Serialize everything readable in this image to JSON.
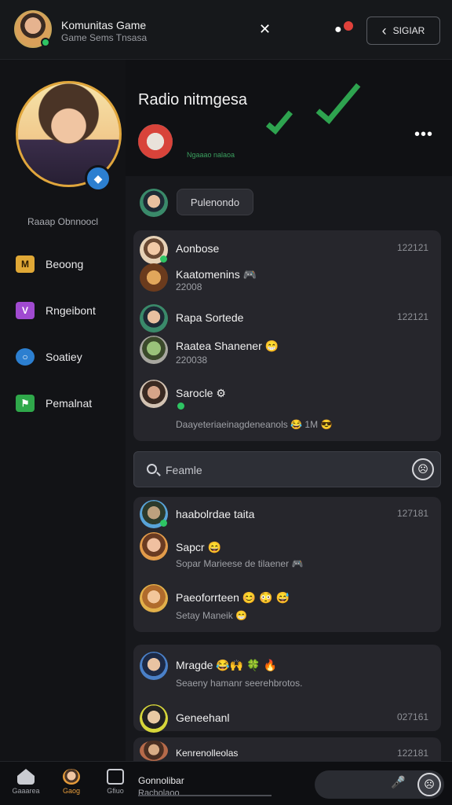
{
  "header": {
    "title": "Komunitas Game",
    "subtitle": "Game Sems Tnsasa",
    "close_glyph": "✕",
    "notifications_glyph": "●",
    "back_button_label": "SIGIAR",
    "back_glyph": "‹"
  },
  "sidebar": {
    "profile_status": "Raaap Obnnoocl",
    "items": [
      {
        "label": "Beoong",
        "icon": "grid-icon",
        "color": "#e0a836",
        "glyph": "M"
      },
      {
        "label": "Rngeibont",
        "icon": "chevron-icon",
        "color": "#a04ad0",
        "glyph": "V"
      },
      {
        "label": "Soatiey",
        "icon": "chat-icon",
        "color": "#2c7fd0",
        "glyph": "○"
      },
      {
        "label": "Pemalnat",
        "icon": "flag-icon",
        "color": "#2fa84a",
        "glyph": "⚑"
      }
    ]
  },
  "main": {
    "title": "Radio nitmgesa",
    "more_glyph": "•••",
    "group_caption": "Ngaaao nalaoa",
    "filter_chip": "Pulenondo",
    "search_placeholder": "Feamle",
    "face_glyph": "☹",
    "emojis": {
      "game": "🎮",
      "grin": "😁",
      "laugh": "😂",
      "cool": "😎",
      "smile": "😄",
      "sweat": "😅",
      "leaf": "🍀",
      "hands": "🙌",
      "face1": "😊",
      "face2": "😳",
      "pizza": "🍕",
      "hundred": "💯",
      "fire": "🔥"
    },
    "card1": [
      {
        "name": "Aonbose",
        "time": "122121"
      },
      {
        "name": "Kaatomenins",
        "sub": "22008"
      },
      {
        "name": "Rapa Sortede",
        "time": "122121"
      },
      {
        "name": "Raatea Shanener",
        "sub": "220038"
      },
      {
        "name": "Sarocle",
        "sub": "Daayeteriaeinagdeneanols",
        "sub_tail": "1M"
      }
    ],
    "card2": [
      {
        "name": "haabolrdae taita",
        "time": "127181"
      },
      {
        "name": "Sapcr",
        "sub": "Sopar Marieese de tilaener"
      },
      {
        "name": "Paeoforrteen",
        "sub": "Setay Maneik"
      }
    ],
    "card3": [
      {
        "name": "Mragde",
        "sub": "Seaeny hamanr seerehbrotos."
      },
      {
        "name": "Geneehanl",
        "time": "027161"
      },
      {
        "name": "Kenrenolleolas",
        "time": "122181"
      }
    ]
  },
  "bottom_nav": {
    "items": [
      {
        "label": "Gaaarea"
      },
      {
        "label": "Gaog"
      },
      {
        "label": "Gfiuo"
      }
    ],
    "compose_label": "Gonnolibar",
    "compose_sub": "Racholaoo",
    "mic_glyph": "🎤",
    "face_glyph": "☹"
  }
}
